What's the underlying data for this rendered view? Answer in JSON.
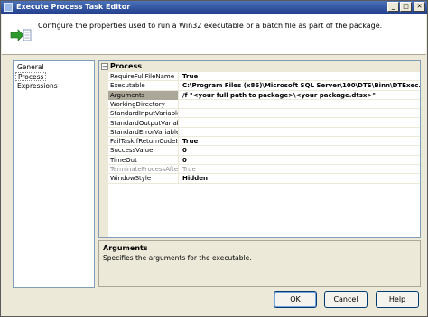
{
  "window": {
    "title": "Execute Process Task Editor",
    "minimize": "_",
    "maximize": "□",
    "close": "✕"
  },
  "header": {
    "description": "Configure the properties used to run a Win32 executable or a batch file as part of the package."
  },
  "nav": {
    "items": [
      {
        "label": "General"
      },
      {
        "label": "Process"
      },
      {
        "label": "Expressions"
      }
    ]
  },
  "grid": {
    "category": "Process",
    "toggle": "−",
    "rows": [
      {
        "name": "RequireFullFileName",
        "value": "True"
      },
      {
        "name": "Executable",
        "value": "C:\\Program Files (x86)\\Microsoft SQL Server\\100\\DTS\\Binn\\DTExec.exe"
      },
      {
        "name": "Arguments",
        "value": "/f \"<your full path to package>\\<your package.dtsx>\""
      },
      {
        "name": "WorkingDirectory",
        "value": ""
      },
      {
        "name": "StandardInputVariable",
        "value": ""
      },
      {
        "name": "StandardOutputVariable",
        "value": ""
      },
      {
        "name": "StandardErrorVariable",
        "value": ""
      },
      {
        "name": "FailTaskIfReturnCodeIsNotSuccessValue",
        "value": "True"
      },
      {
        "name": "SuccessValue",
        "value": "0"
      },
      {
        "name": "TimeOut",
        "value": "0"
      },
      {
        "name": "TerminateProcessAfterTimeOut",
        "value": "True"
      },
      {
        "name": "WindowStyle",
        "value": "Hidden"
      }
    ]
  },
  "description_pane": {
    "title": "Arguments",
    "text": "Specifies the arguments for the executable."
  },
  "buttons": {
    "ok": "OK",
    "cancel": "Cancel",
    "help": "Help"
  }
}
